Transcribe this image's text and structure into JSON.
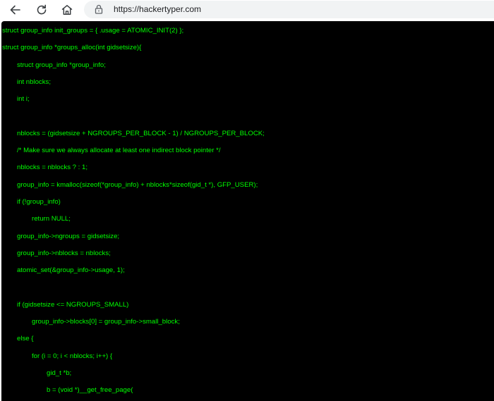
{
  "browser": {
    "url": "https://hackertyper.com"
  },
  "terminal": {
    "lines": [
      {
        "indent": 0,
        "text": "struct group_info init_groups = { .usage = ATOMIC_INIT(2) };"
      },
      {
        "indent": 0,
        "text": "struct group_info *groups_alloc(int gidsetsize){"
      },
      {
        "indent": 1,
        "text": "struct group_info *group_info;"
      },
      {
        "indent": 1,
        "text": "int nblocks;"
      },
      {
        "indent": 1,
        "text": "int i;"
      },
      {
        "indent": 0,
        "text": ""
      },
      {
        "indent": 1,
        "text": "nblocks = (gidsetsize + NGROUPS_PER_BLOCK - 1) / NGROUPS_PER_BLOCK;"
      },
      {
        "indent": 1,
        "text": "/* Make sure we always allocate at least one indirect block pointer */"
      },
      {
        "indent": 1,
        "text": "nblocks = nblocks ? : 1;"
      },
      {
        "indent": 1,
        "text": "group_info = kmalloc(sizeof(*group_info) + nblocks*sizeof(gid_t *), GFP_USER);"
      },
      {
        "indent": 1,
        "text": "if (!group_info)"
      },
      {
        "indent": 2,
        "text": "return NULL;"
      },
      {
        "indent": 1,
        "text": "group_info->ngroups = gidsetsize;"
      },
      {
        "indent": 1,
        "text": "group_info->nblocks = nblocks;"
      },
      {
        "indent": 1,
        "text": "atomic_set(&group_info->usage, 1);"
      },
      {
        "indent": 0,
        "text": ""
      },
      {
        "indent": 1,
        "text": "if (gidsetsize <= NGROUPS_SMALL)"
      },
      {
        "indent": 2,
        "text": "group_info->blocks[0] = group_info->small_block;"
      },
      {
        "indent": 1,
        "text": "else {"
      },
      {
        "indent": 2,
        "text": "for (i = 0; i < nblocks; i++) {"
      },
      {
        "indent": 3,
        "text": "gid_t *b;"
      },
      {
        "indent": 3,
        "text": "b = (void *)__get_free_page("
      }
    ]
  },
  "colors": {
    "terminal_bg": "#000000",
    "terminal_text": "#00ff00",
    "address_bar_bg": "#f1f3f4"
  },
  "icons": {
    "back": "back-arrow-icon",
    "reload": "reload-icon",
    "home": "home-icon",
    "site_info": "lock-icon"
  }
}
